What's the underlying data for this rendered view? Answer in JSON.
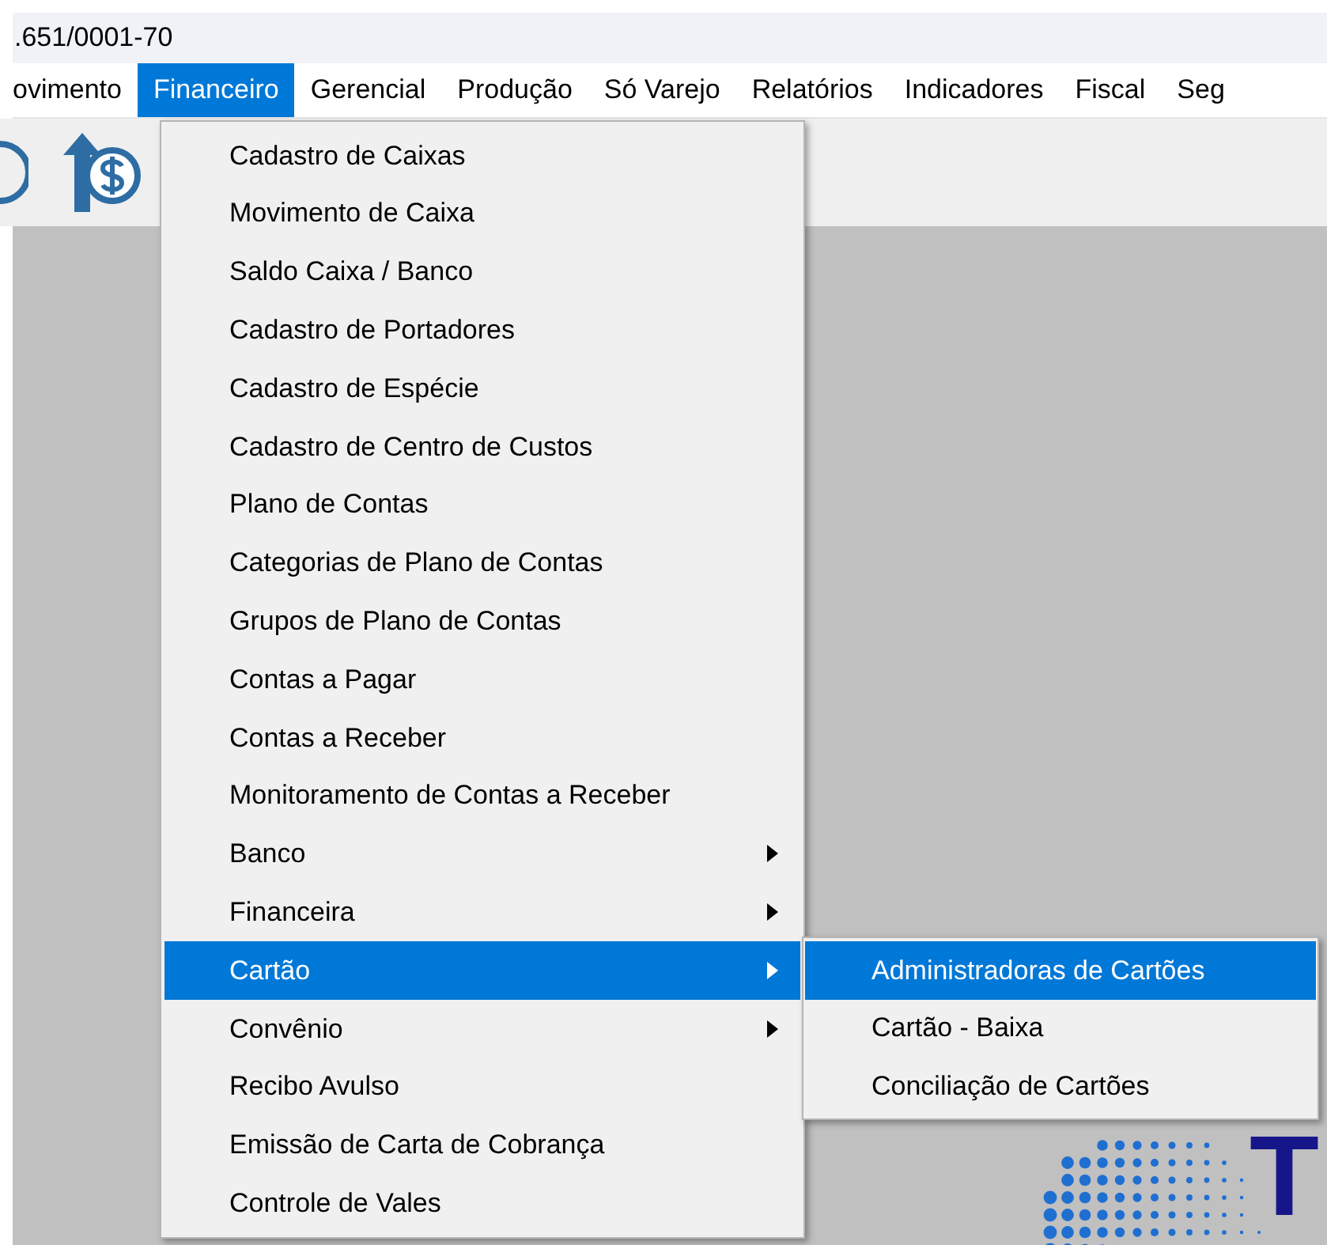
{
  "window": {
    "title": ".651/0001-70"
  },
  "menu_bar": [
    {
      "label": "ovimento",
      "selected": false
    },
    {
      "label": "Financeiro",
      "selected": true
    },
    {
      "label": "Gerencial",
      "selected": false
    },
    {
      "label": "Produção",
      "selected": false
    },
    {
      "label": "Só Varejo",
      "selected": false
    },
    {
      "label": "Relatórios",
      "selected": false
    },
    {
      "label": "Indicadores",
      "selected": false
    },
    {
      "label": "Fiscal",
      "selected": false
    },
    {
      "label": "Seg",
      "selected": false
    }
  ],
  "dropdown": [
    {
      "label": "Cadastro de Caixas",
      "selected": false,
      "submenu": false
    },
    {
      "label": "Movimento de Caixa",
      "selected": false,
      "submenu": false
    },
    {
      "label": "Saldo Caixa / Banco",
      "selected": false,
      "submenu": false
    },
    {
      "label": "Cadastro de Portadores",
      "selected": false,
      "submenu": false
    },
    {
      "label": "Cadastro de Espécie",
      "selected": false,
      "submenu": false
    },
    {
      "label": "Cadastro de Centro de Custos",
      "selected": false,
      "submenu": false
    },
    {
      "label": "Plano de Contas",
      "selected": false,
      "submenu": false
    },
    {
      "label": "Categorias de Plano de Contas",
      "selected": false,
      "submenu": false
    },
    {
      "label": "Grupos de Plano de Contas",
      "selected": false,
      "submenu": false
    },
    {
      "label": "Contas a Pagar",
      "selected": false,
      "submenu": false
    },
    {
      "label": "Contas a Receber",
      "selected": false,
      "submenu": false
    },
    {
      "label": "Monitoramento de Contas a Receber",
      "selected": false,
      "submenu": false
    },
    {
      "label": "Banco",
      "selected": false,
      "submenu": true
    },
    {
      "label": "Financeira",
      "selected": false,
      "submenu": true
    },
    {
      "label": "Cartão",
      "selected": true,
      "submenu": true
    },
    {
      "label": "Convênio",
      "selected": false,
      "submenu": true
    },
    {
      "label": "Recibo Avulso",
      "selected": false,
      "submenu": false
    },
    {
      "label": "Emissão de Carta de Cobrança",
      "selected": false,
      "submenu": false
    },
    {
      "label": "Controle de Vales",
      "selected": false,
      "submenu": false
    }
  ],
  "submenu": [
    {
      "label": "Administradoras de Cartões",
      "selected": true
    },
    {
      "label": "Cartão - Baixa",
      "selected": false
    },
    {
      "label": "Conciliação de Cartões",
      "selected": false
    }
  ],
  "logo": {
    "text": "T"
  }
}
